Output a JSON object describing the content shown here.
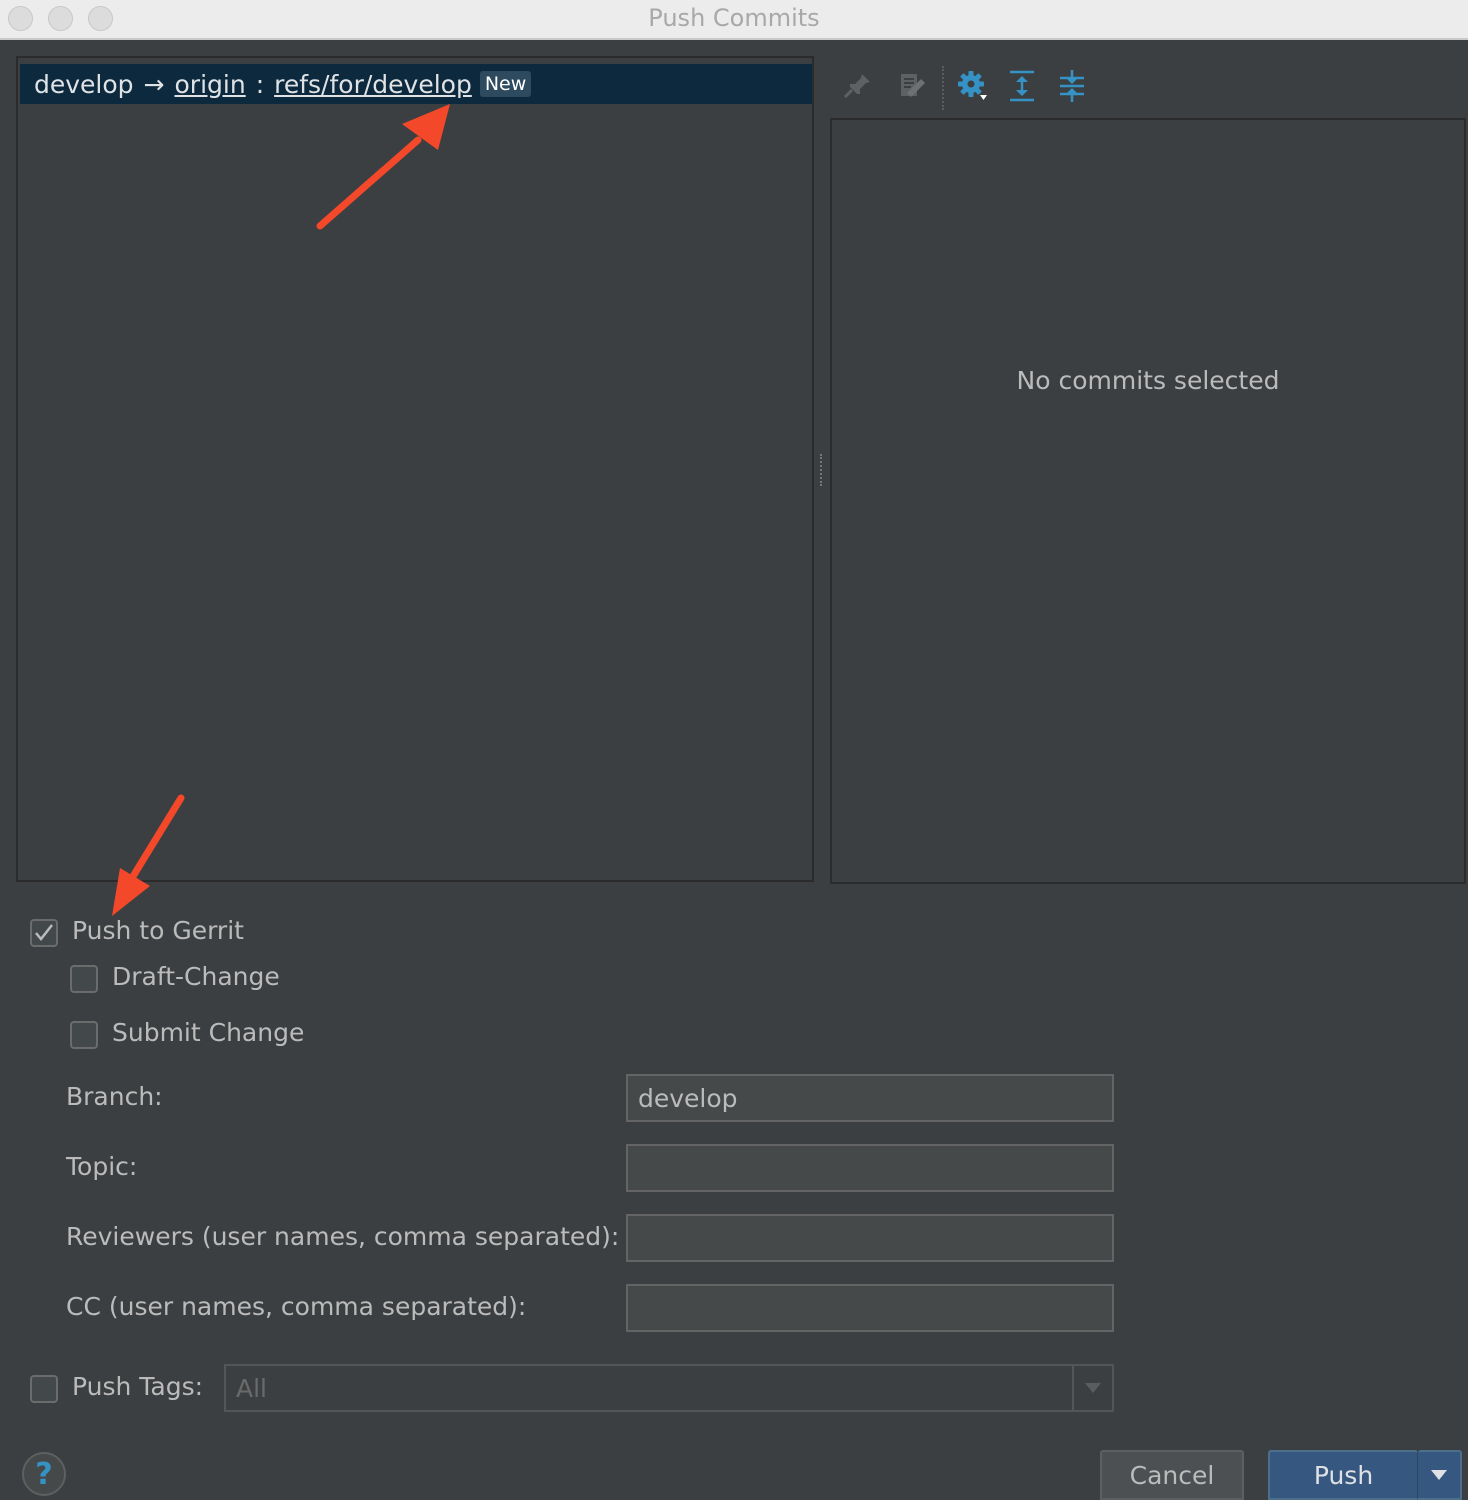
{
  "window": {
    "title": "Push Commits"
  },
  "push_row": {
    "local_branch": "develop",
    "arrow": "→",
    "remote": "origin",
    "separator": ":",
    "target_ref": "refs/for/develop",
    "tag": "New"
  },
  "details": {
    "empty_text": "No commits selected"
  },
  "toolbar": {
    "icons": [
      "pin-icon",
      "edit-icon",
      "gear-icon",
      "expand-all-icon",
      "collapse-all-icon"
    ]
  },
  "gerrit": {
    "push_to_gerrit": {
      "label": "Push to Gerrit",
      "checked": true
    },
    "draft_change": {
      "label": "Draft-Change",
      "checked": false
    },
    "submit_change": {
      "label": "Submit Change",
      "checked": false
    },
    "branch": {
      "label": "Branch:",
      "value": "develop"
    },
    "topic": {
      "label": "Topic:",
      "value": ""
    },
    "reviewers": {
      "label": "Reviewers (user names, comma separated):",
      "value": ""
    },
    "cc": {
      "label": "CC (user names, comma separated):",
      "value": ""
    }
  },
  "push_tags": {
    "label": "Push Tags:",
    "checked": false,
    "value": "All"
  },
  "buttons": {
    "help": "?",
    "cancel": "Cancel",
    "push": "Push"
  },
  "colors": {
    "accent": "#365880",
    "selection": "#0d293e",
    "annotation": "#f4482a",
    "icon_blue": "#3592c4"
  }
}
